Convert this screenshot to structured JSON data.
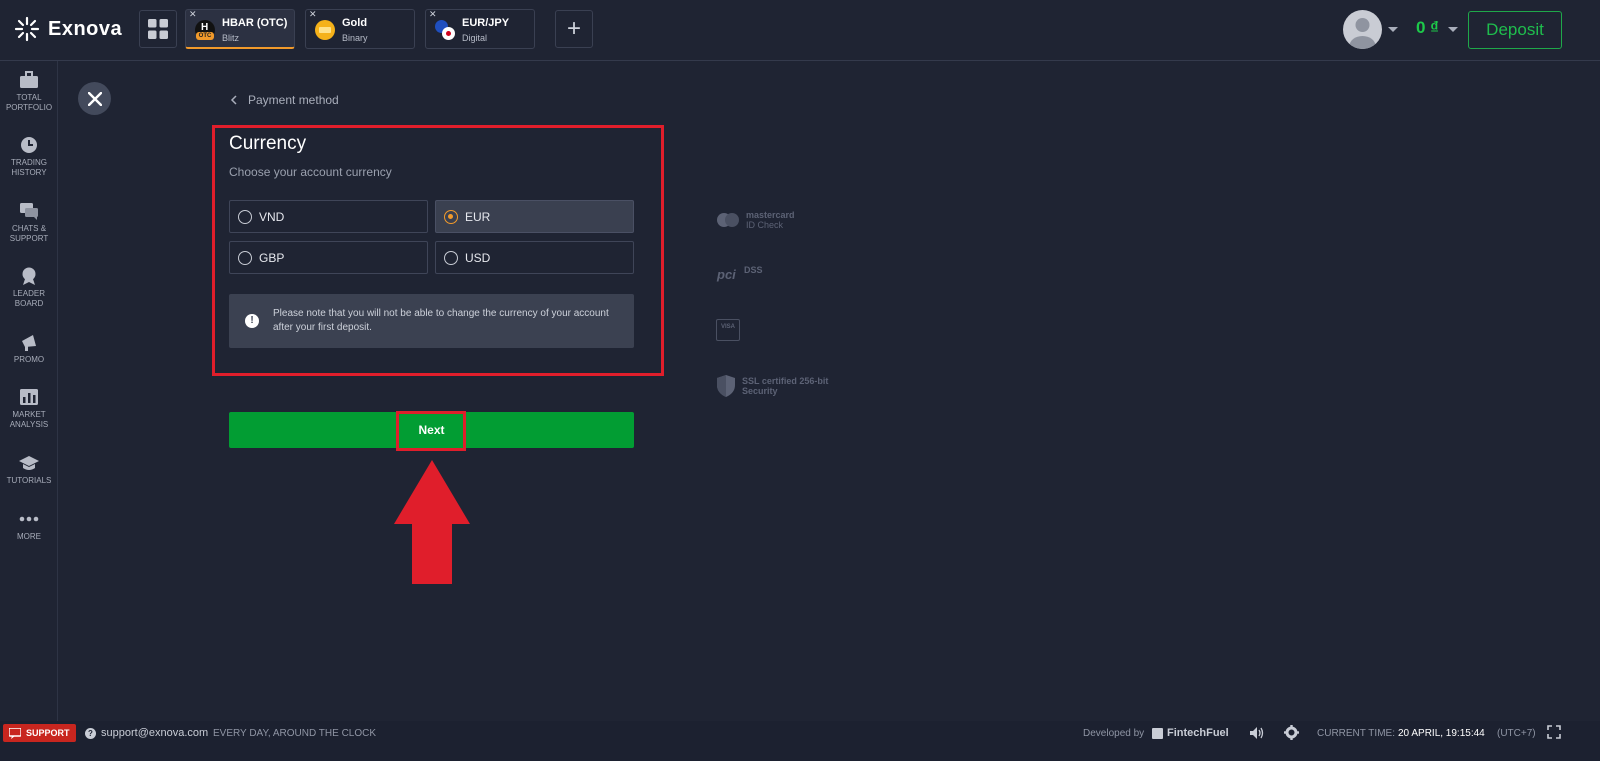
{
  "header": {
    "brand": "Exnova",
    "tabs": [
      {
        "name": "HBAR (OTC)",
        "sub": "Blitz",
        "badge": "OTC"
      },
      {
        "name": "Gold",
        "sub": "Binary"
      },
      {
        "name": "EUR/JPY",
        "sub": "Digital"
      }
    ],
    "balance": "0 ₫",
    "deposit_label": "Deposit"
  },
  "sidebar": {
    "items": [
      {
        "label": "TOTAL\nPORTFOLIO",
        "icon": "briefcase-icon"
      },
      {
        "label": "TRADING\nHISTORY",
        "icon": "clock-icon"
      },
      {
        "label": "CHATS &\nSUPPORT",
        "icon": "chat-icon"
      },
      {
        "label": "LEADER\nBOARD",
        "icon": "medal-icon"
      },
      {
        "label": "PROMO",
        "icon": "megaphone-icon"
      },
      {
        "label": "MARKET\nANALYSIS",
        "icon": "chart-icon"
      },
      {
        "label": "TUTORIALS",
        "icon": "graduation-cap-icon"
      },
      {
        "label": "MORE",
        "icon": "more-dots-icon"
      }
    ]
  },
  "main": {
    "back_label": "Payment method",
    "title": "Currency",
    "subtitle": "Choose your account currency",
    "options": [
      {
        "label": "VND",
        "selected": false
      },
      {
        "label": "EUR",
        "selected": true
      },
      {
        "label": "GBP",
        "selected": false
      },
      {
        "label": "USD",
        "selected": false
      }
    ],
    "note": "Please note that you will not be able to change the currency of your account after your first deposit.",
    "next_label": "Next"
  },
  "badges": {
    "mastercard_1": "mastercard",
    "mastercard_2": "ID Check",
    "pci": "DSS",
    "visa": "VISA",
    "ssl_1": "SSL certified 256-bit",
    "ssl_2": "Security"
  },
  "footer": {
    "support_label": "SUPPORT",
    "email": "support@exnova.com",
    "hours": "EVERY DAY, AROUND THE CLOCK",
    "developed_by": "Developed by",
    "developer": "FintechFuel",
    "time_label": "CURRENT TIME:",
    "time_value": "20 APRIL, 19:15:44",
    "timezone": "(UTC+7)"
  },
  "colors": {
    "background": "#1f2433",
    "accent_green": "#029d33",
    "highlight_red": "#e01e2b",
    "radio_selected": "#f29a2b"
  }
}
